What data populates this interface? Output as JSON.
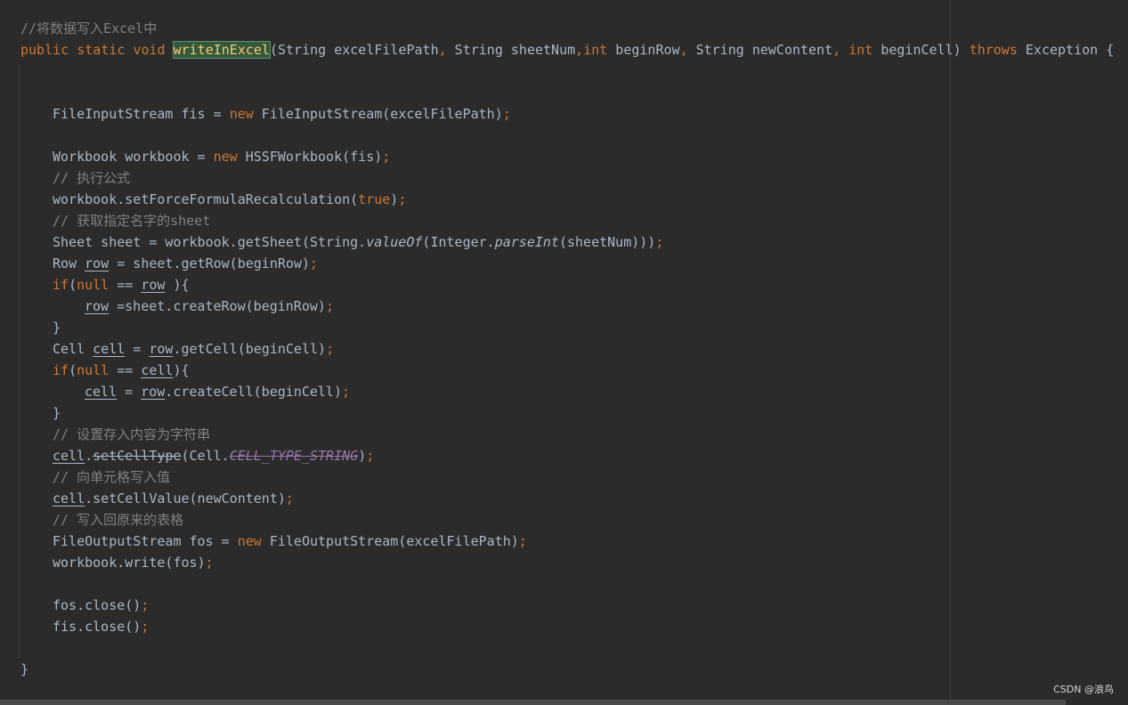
{
  "code": {
    "comment_header": "//将数据写入Excel中",
    "sig": {
      "kw_public": "public",
      "kw_static": "static",
      "kw_void": "void",
      "method_name": "writeInExcel",
      "p1": "(String excelFilePath",
      "c1": ",",
      "p2": " String sheetNum",
      "c2": ",",
      "kw_int1": "int",
      "p3": " beginRow",
      "c3": ",",
      "p4": " String newContent",
      "c4": ",",
      "kw_int2": "int",
      "p5": " beginCell)",
      "kw_throws": "throws",
      "p6": " Exception {"
    },
    "l_fis": {
      "a": "FileInputStream fis = ",
      "kw": "new",
      "b": " FileInputStream(excelFilePath)",
      "semi": ";"
    },
    "l_wb": {
      "a": "Workbook workbook = ",
      "kw": "new",
      "b": " HSSFWorkbook(fis)",
      "semi": ";"
    },
    "c_exec": "// 执行公式",
    "l_force": {
      "a": "workbook.setForceFormulaRecalculation(",
      "kw": "true",
      "b": ")",
      "semi": ";"
    },
    "c_getsheet": "// 获取指定名字的sheet",
    "l_sheet": {
      "a": "Sheet sheet = workbook.getSheet(String.",
      "i1": "valueOf",
      "b": "(Integer.",
      "i2": "parseInt",
      "c": "(sheetNum)))",
      "semi": ";"
    },
    "l_row": {
      "a": "Row ",
      "v": "row",
      "b": " = sheet.getRow(beginRow)",
      "semi": ";"
    },
    "l_ifrow": {
      "kw": "if",
      "a": "(",
      "kw2": "null",
      "b": " == ",
      "v": "row",
      "c": " ){"
    },
    "l_createrow": {
      "v": "row",
      "a": " =sheet.createRow(beginRow)",
      "semi": ";"
    },
    "brace_close": "}",
    "l_cell": {
      "a": "Cell ",
      "v": "cell",
      "b": " = ",
      "v2": "row",
      "c": ".getCell(beginCell)",
      "semi": ";"
    },
    "l_ifcell": {
      "kw": "if",
      "a": "(",
      "kw2": "null",
      "b": " == ",
      "v": "cell",
      "c": "){"
    },
    "l_createcell": {
      "v": "cell",
      "a": " = ",
      "v2": "row",
      "b": ".createCell(beginCell)",
      "semi": ";"
    },
    "c_settype": "// 设置存入内容为字符串",
    "l_settype": {
      "v": "cell",
      "a": ".",
      "dep": "setCellType",
      "b": "(Cell.",
      "cst": "CELL_TYPE_STRING",
      "c": ")",
      "semi": ";"
    },
    "c_write": "// 向单元格写入值",
    "l_setval": {
      "v": "cell",
      "a": ".setCellValue(newContent)",
      "semi": ";"
    },
    "c_back": "// 写入回原来的表格",
    "l_fos": {
      "a": "FileOutputStream fos = ",
      "kw": "new",
      "b": " FileOutputStream(excelFilePath)",
      "semi": ";"
    },
    "l_wbwrite": {
      "a": "workbook.write(fos)",
      "semi": ";"
    },
    "l_fosclose": {
      "a": "fos.close()",
      "semi": ";"
    },
    "l_fisclose": {
      "a": "fis.close()",
      "semi": ";"
    },
    "final_brace": "}"
  },
  "watermark": "CSDN @浪鸟"
}
